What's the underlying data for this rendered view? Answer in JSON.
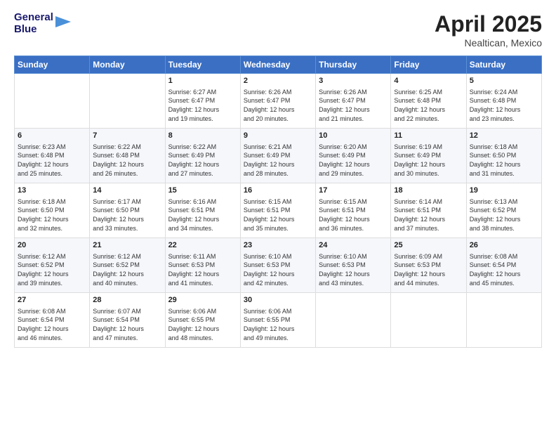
{
  "header": {
    "logo_line1": "General",
    "logo_line2": "Blue",
    "month_title": "April 2025",
    "subtitle": "Nealtican, Mexico"
  },
  "days_of_week": [
    "Sunday",
    "Monday",
    "Tuesday",
    "Wednesday",
    "Thursday",
    "Friday",
    "Saturday"
  ],
  "weeks": [
    [
      {
        "day": "",
        "info": ""
      },
      {
        "day": "",
        "info": ""
      },
      {
        "day": "1",
        "sunrise": "6:27 AM",
        "sunset": "6:47 PM",
        "daylight": "12 hours and 19 minutes."
      },
      {
        "day": "2",
        "sunrise": "6:26 AM",
        "sunset": "6:47 PM",
        "daylight": "12 hours and 20 minutes."
      },
      {
        "day": "3",
        "sunrise": "6:26 AM",
        "sunset": "6:47 PM",
        "daylight": "12 hours and 21 minutes."
      },
      {
        "day": "4",
        "sunrise": "6:25 AM",
        "sunset": "6:48 PM",
        "daylight": "12 hours and 22 minutes."
      },
      {
        "day": "5",
        "sunrise": "6:24 AM",
        "sunset": "6:48 PM",
        "daylight": "12 hours and 23 minutes."
      }
    ],
    [
      {
        "day": "6",
        "sunrise": "6:23 AM",
        "sunset": "6:48 PM",
        "daylight": "12 hours and 25 minutes."
      },
      {
        "day": "7",
        "sunrise": "6:22 AM",
        "sunset": "6:48 PM",
        "daylight": "12 hours and 26 minutes."
      },
      {
        "day": "8",
        "sunrise": "6:22 AM",
        "sunset": "6:49 PM",
        "daylight": "12 hours and 27 minutes."
      },
      {
        "day": "9",
        "sunrise": "6:21 AM",
        "sunset": "6:49 PM",
        "daylight": "12 hours and 28 minutes."
      },
      {
        "day": "10",
        "sunrise": "6:20 AM",
        "sunset": "6:49 PM",
        "daylight": "12 hours and 29 minutes."
      },
      {
        "day": "11",
        "sunrise": "6:19 AM",
        "sunset": "6:49 PM",
        "daylight": "12 hours and 30 minutes."
      },
      {
        "day": "12",
        "sunrise": "6:18 AM",
        "sunset": "6:50 PM",
        "daylight": "12 hours and 31 minutes."
      }
    ],
    [
      {
        "day": "13",
        "sunrise": "6:18 AM",
        "sunset": "6:50 PM",
        "daylight": "12 hours and 32 minutes."
      },
      {
        "day": "14",
        "sunrise": "6:17 AM",
        "sunset": "6:50 PM",
        "daylight": "12 hours and 33 minutes."
      },
      {
        "day": "15",
        "sunrise": "6:16 AM",
        "sunset": "6:51 PM",
        "daylight": "12 hours and 34 minutes."
      },
      {
        "day": "16",
        "sunrise": "6:15 AM",
        "sunset": "6:51 PM",
        "daylight": "12 hours and 35 minutes."
      },
      {
        "day": "17",
        "sunrise": "6:15 AM",
        "sunset": "6:51 PM",
        "daylight": "12 hours and 36 minutes."
      },
      {
        "day": "18",
        "sunrise": "6:14 AM",
        "sunset": "6:51 PM",
        "daylight": "12 hours and 37 minutes."
      },
      {
        "day": "19",
        "sunrise": "6:13 AM",
        "sunset": "6:52 PM",
        "daylight": "12 hours and 38 minutes."
      }
    ],
    [
      {
        "day": "20",
        "sunrise": "6:12 AM",
        "sunset": "6:52 PM",
        "daylight": "12 hours and 39 minutes."
      },
      {
        "day": "21",
        "sunrise": "6:12 AM",
        "sunset": "6:52 PM",
        "daylight": "12 hours and 40 minutes."
      },
      {
        "day": "22",
        "sunrise": "6:11 AM",
        "sunset": "6:53 PM",
        "daylight": "12 hours and 41 minutes."
      },
      {
        "day": "23",
        "sunrise": "6:10 AM",
        "sunset": "6:53 PM",
        "daylight": "12 hours and 42 minutes."
      },
      {
        "day": "24",
        "sunrise": "6:10 AM",
        "sunset": "6:53 PM",
        "daylight": "12 hours and 43 minutes."
      },
      {
        "day": "25",
        "sunrise": "6:09 AM",
        "sunset": "6:53 PM",
        "daylight": "12 hours and 44 minutes."
      },
      {
        "day": "26",
        "sunrise": "6:08 AM",
        "sunset": "6:54 PM",
        "daylight": "12 hours and 45 minutes."
      }
    ],
    [
      {
        "day": "27",
        "sunrise": "6:08 AM",
        "sunset": "6:54 PM",
        "daylight": "12 hours and 46 minutes."
      },
      {
        "day": "28",
        "sunrise": "6:07 AM",
        "sunset": "6:54 PM",
        "daylight": "12 hours and 47 minutes."
      },
      {
        "day": "29",
        "sunrise": "6:06 AM",
        "sunset": "6:55 PM",
        "daylight": "12 hours and 48 minutes."
      },
      {
        "day": "30",
        "sunrise": "6:06 AM",
        "sunset": "6:55 PM",
        "daylight": "12 hours and 49 minutes."
      },
      {
        "day": "",
        "info": ""
      },
      {
        "day": "",
        "info": ""
      },
      {
        "day": "",
        "info": ""
      }
    ]
  ],
  "labels": {
    "sunrise_prefix": "Sunrise: ",
    "sunset_prefix": "Sunset: ",
    "daylight_prefix": "Daylight: "
  }
}
